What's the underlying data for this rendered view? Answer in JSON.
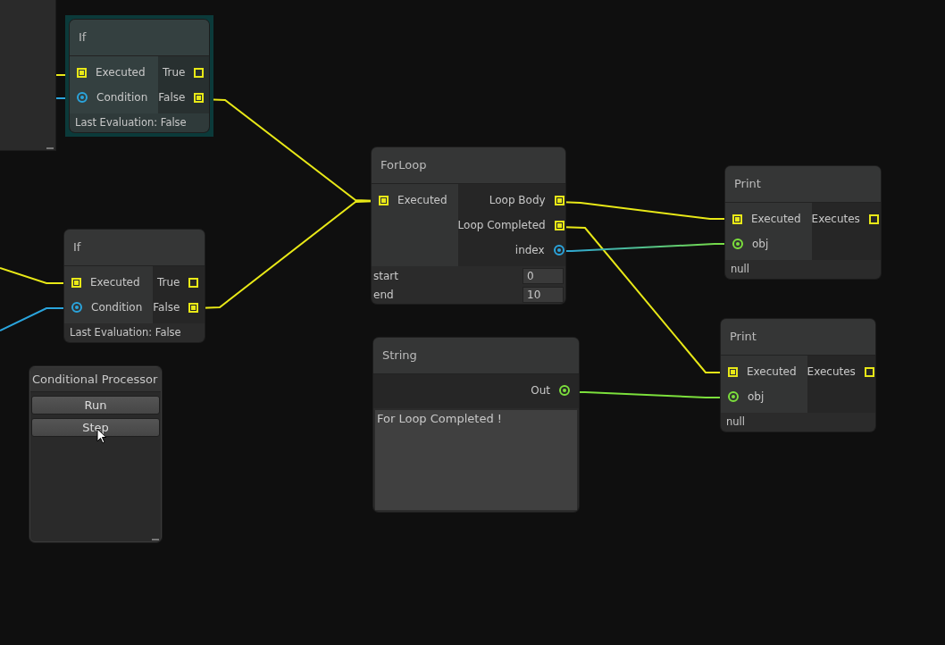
{
  "nodes": [
    {
      "kind": "partial",
      "selected": false
    },
    {
      "kind": "node",
      "title": "If",
      "selected": true,
      "inputs": [
        {
          "label": "Executed",
          "kind": "exec",
          "color": "#e8e817",
          "connected": true
        },
        {
          "label": "Condition",
          "kind": "value",
          "color": "#2aa4dc",
          "connected": true
        }
      ],
      "outputs": [
        {
          "label": "True",
          "kind": "exec",
          "color": "#e8e817",
          "connected": false
        },
        {
          "label": "False",
          "kind": "exec",
          "color": "#e8e817",
          "connected": true
        }
      ],
      "footer": "Last Evaluation: False"
    },
    {
      "kind": "node",
      "title": "If",
      "selected": false,
      "inputs": [
        {
          "label": "Executed",
          "kind": "exec",
          "color": "#e8e817",
          "connected": true
        },
        {
          "label": "Condition",
          "kind": "value",
          "color": "#2aa4dc",
          "connected": true
        }
      ],
      "outputs": [
        {
          "label": "True",
          "kind": "exec",
          "color": "#e8e817",
          "connected": false
        },
        {
          "label": "False",
          "kind": "exec",
          "color": "#e8e817",
          "connected": true
        }
      ],
      "footer": "Last Evaluation: False"
    },
    {
      "kind": "processor",
      "title": "Conditional Processor",
      "selected": false,
      "buttons": [
        "Run",
        "Step"
      ]
    },
    {
      "kind": "node",
      "title": "ForLoop",
      "selected": false,
      "inputs": [
        {
          "label": "Executed",
          "kind": "exec",
          "color": "#e8e817",
          "connected": true
        }
      ],
      "outputs": [
        {
          "label": "Loop Body",
          "kind": "exec",
          "color": "#e8e817",
          "connected": true
        },
        {
          "label": "Loop Completed",
          "kind": "exec",
          "color": "#e8e817",
          "connected": true
        },
        {
          "label": "index",
          "kind": "value",
          "color": "#2aa4dc",
          "connected": true
        }
      ],
      "fields": [
        {
          "label": "start",
          "value": "0"
        },
        {
          "label": "end",
          "value": "10"
        }
      ]
    },
    {
      "kind": "node",
      "title": "String",
      "selected": false,
      "outputs": [
        {
          "label": "Out",
          "kind": "value",
          "color": "#7ce03c",
          "connected": true
        }
      ],
      "text": "For Loop Completed !"
    },
    {
      "kind": "node",
      "title": "Print",
      "selected": false,
      "inputs": [
        {
          "label": "Executed",
          "kind": "exec",
          "color": "#e8e817",
          "connected": true
        },
        {
          "label": "obj",
          "kind": "value",
          "color": "#7ce03c",
          "connected": true
        }
      ],
      "outputs": [
        {
          "label": "Executes",
          "kind": "exec",
          "color": "#e8e817",
          "connected": false
        }
      ],
      "footer": "null"
    },
    {
      "kind": "node",
      "title": "Print",
      "selected": false,
      "inputs": [
        {
          "label": "Executed",
          "kind": "exec",
          "color": "#e8e817",
          "connected": true
        },
        {
          "label": "obj",
          "kind": "value",
          "color": "#7ce03c",
          "connected": true
        }
      ],
      "outputs": [
        {
          "label": "Executes",
          "kind": "exec",
          "color": "#e8e817",
          "connected": false
        }
      ],
      "footer": "null"
    }
  ]
}
